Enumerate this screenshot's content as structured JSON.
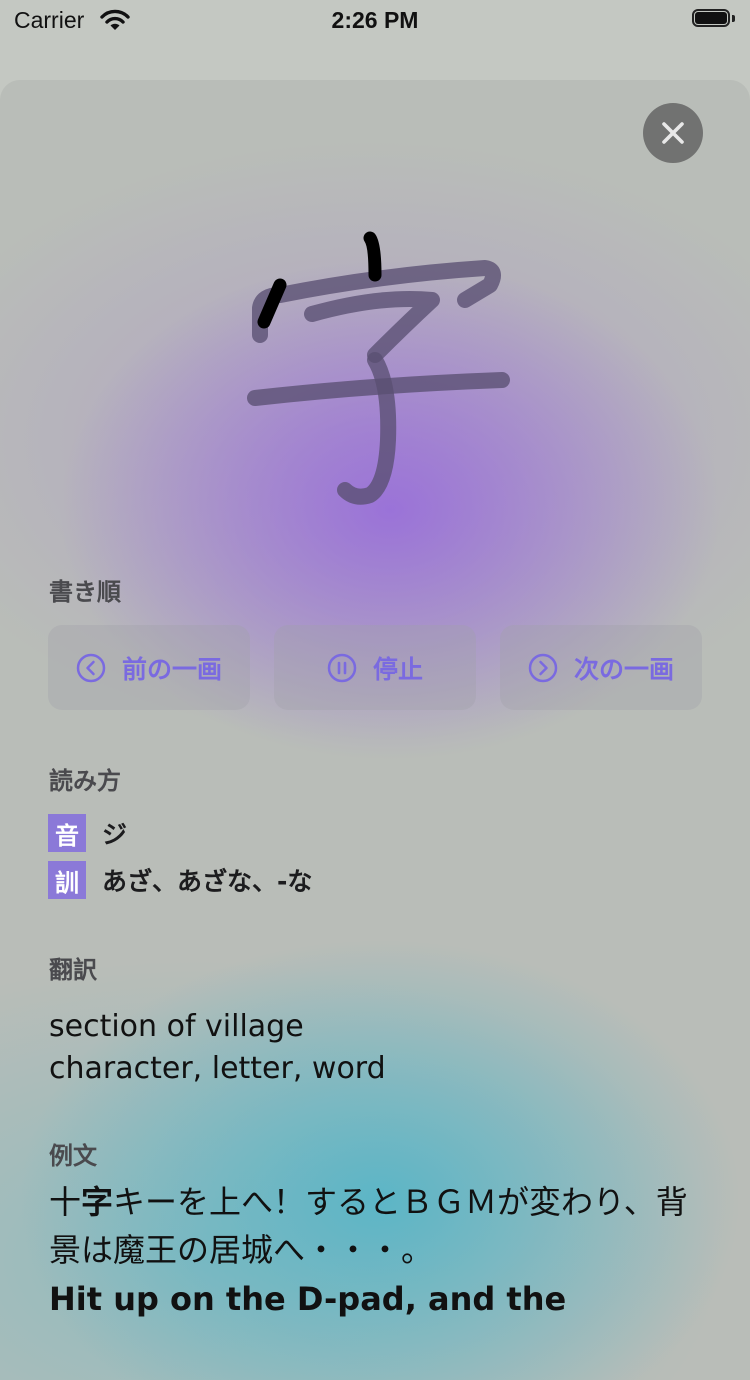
{
  "status_bar": {
    "carrier": "Carrier",
    "time": "2:26 PM"
  },
  "kanji": {
    "character": "字",
    "icon": "close-icon"
  },
  "stroke_order": {
    "label": "書き順",
    "prev_label": "前の一画",
    "stop_label": "停止",
    "next_label": "次の一画"
  },
  "readings": {
    "label": "読み方",
    "items": [
      {
        "badge": "音",
        "text": "ジ"
      },
      {
        "badge": "訓",
        "text": "あざ、あざな、-な"
      }
    ]
  },
  "translation": {
    "label": "翻訳",
    "lines": [
      "section of village",
      "character, letter, word"
    ]
  },
  "example": {
    "label": "例文",
    "jp_before": "十",
    "jp_highlight": "字",
    "jp_after": "キーを上へ！するとＢＧＭが変わり、背景は魔王の居城へ・・・。",
    "en": "Hit up on the D-pad, and the"
  },
  "colors": {
    "accent": "#7a6ae0",
    "badge": "#8b79d8"
  }
}
